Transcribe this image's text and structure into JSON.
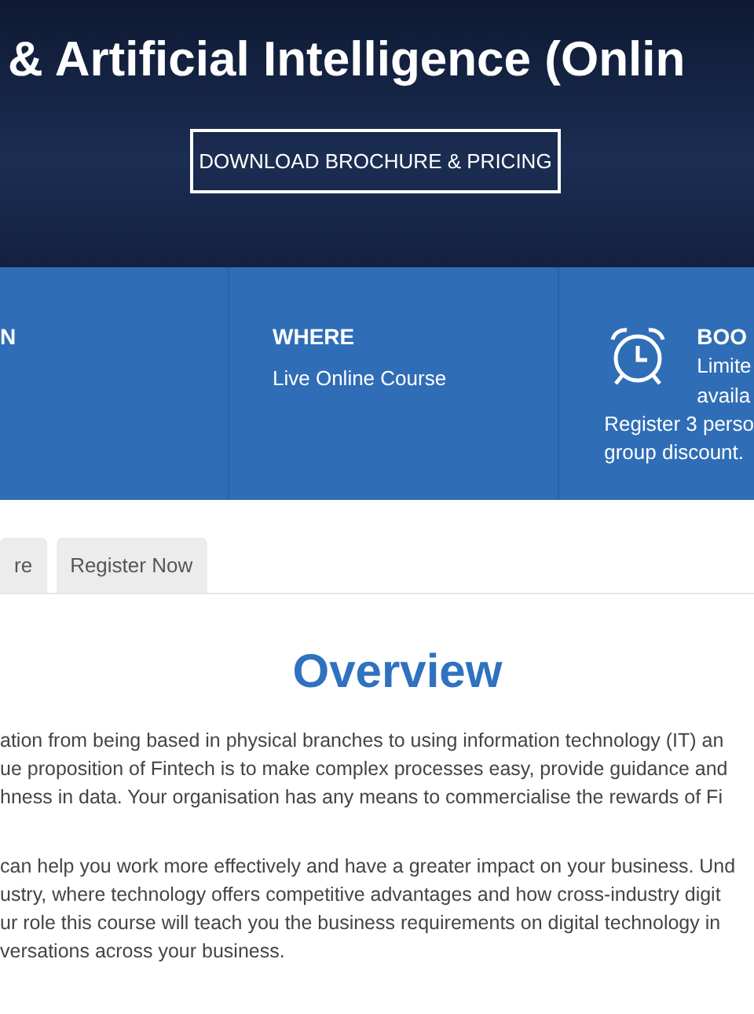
{
  "hero": {
    "title": "& Artificial Intelligence (Onlin",
    "button": "DOWNLOAD BROCHURE & PRICING"
  },
  "info": {
    "col1": {
      "heading": "N"
    },
    "col2": {
      "heading": "WHERE",
      "text": "Live Online Course"
    },
    "col3": {
      "heading": "BOO",
      "lines": [
        "Limite",
        "availa"
      ],
      "note": [
        "Register 3 perso",
        "group discount."
      ]
    }
  },
  "tabs": [
    {
      "label": "re",
      "selected": false
    },
    {
      "label": "Register Now",
      "selected": false
    }
  ],
  "overview": {
    "heading": "Overview",
    "paragraphs": [
      [
        "ation from being based in physical branches to using information technology (IT) an",
        "ue proposition of Fintech is to make complex processes easy, provide guidance and",
        "hness in data. Your organisation has any means to commercialise the rewards of Fi"
      ],
      [
        "can help you work more effectively and have a greater impact on your business. Und",
        "ustry, where technology offers competitive advantages and how cross-industry digit",
        "ur role this course will teach you the business requirements on digital technology in",
        "versations across your business."
      ]
    ]
  }
}
